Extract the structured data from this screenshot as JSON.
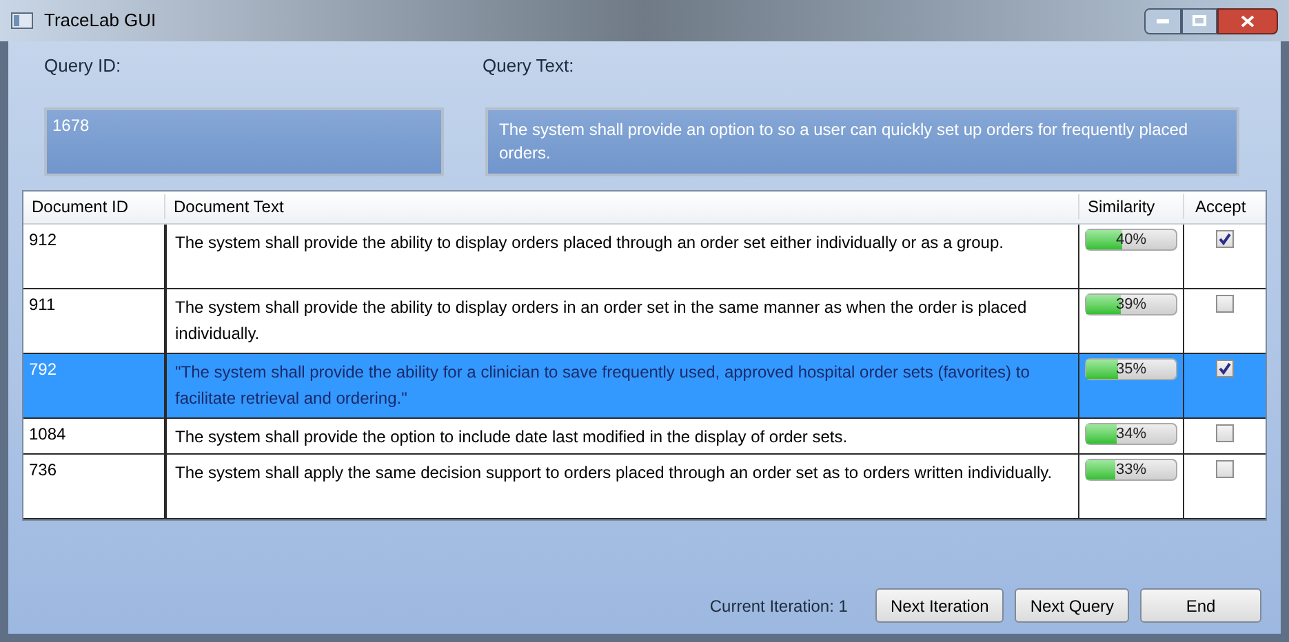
{
  "window": {
    "title": "TraceLab GUI"
  },
  "query": {
    "id_label": "Query ID:",
    "text_label": "Query Text:",
    "id_value": "1678",
    "text_value": "The system shall provide an option to so a user can quickly set up orders for frequently placed orders."
  },
  "table": {
    "columns": [
      "Document ID",
      "Document Text",
      "Similarity",
      "Accept"
    ],
    "rows": [
      {
        "id": "912",
        "text": "The system shall provide the ability to display orders placed through an order set either individually or as a group.",
        "level": 0.4,
        "reading": "40%",
        "checked": true,
        "selected": false
      },
      {
        "id": "911",
        "text": "The system shall provide the ability to display orders in an order set in the same manner as when the order is placed individually.",
        "level": 0.39,
        "reading": "39%",
        "checked": false,
        "selected": false
      },
      {
        "id": "792",
        "text": "\"The system shall provide the ability for a  clinician to save frequently used, approved hospital order sets (favorites) to facilitate retrieval and ordering.\"",
        "level": 0.35,
        "reading": "35%",
        "checked": true,
        "selected": true
      },
      {
        "id": "1084",
        "text": "The system shall provide the option to include date last modified in the display of order sets.",
        "level": 0.34,
        "reading": "34%",
        "checked": false,
        "selected": false
      },
      {
        "id": "736",
        "text": "The system shall apply the same decision support to orders placed through an order set as to orders written individually.",
        "level": 0.33,
        "reading": "33%",
        "checked": false,
        "selected": false
      }
    ]
  },
  "footer": {
    "iteration": "Current Iteration: 1",
    "buttons": [
      "Next Iteration",
      "Next Query",
      "End"
    ]
  }
}
